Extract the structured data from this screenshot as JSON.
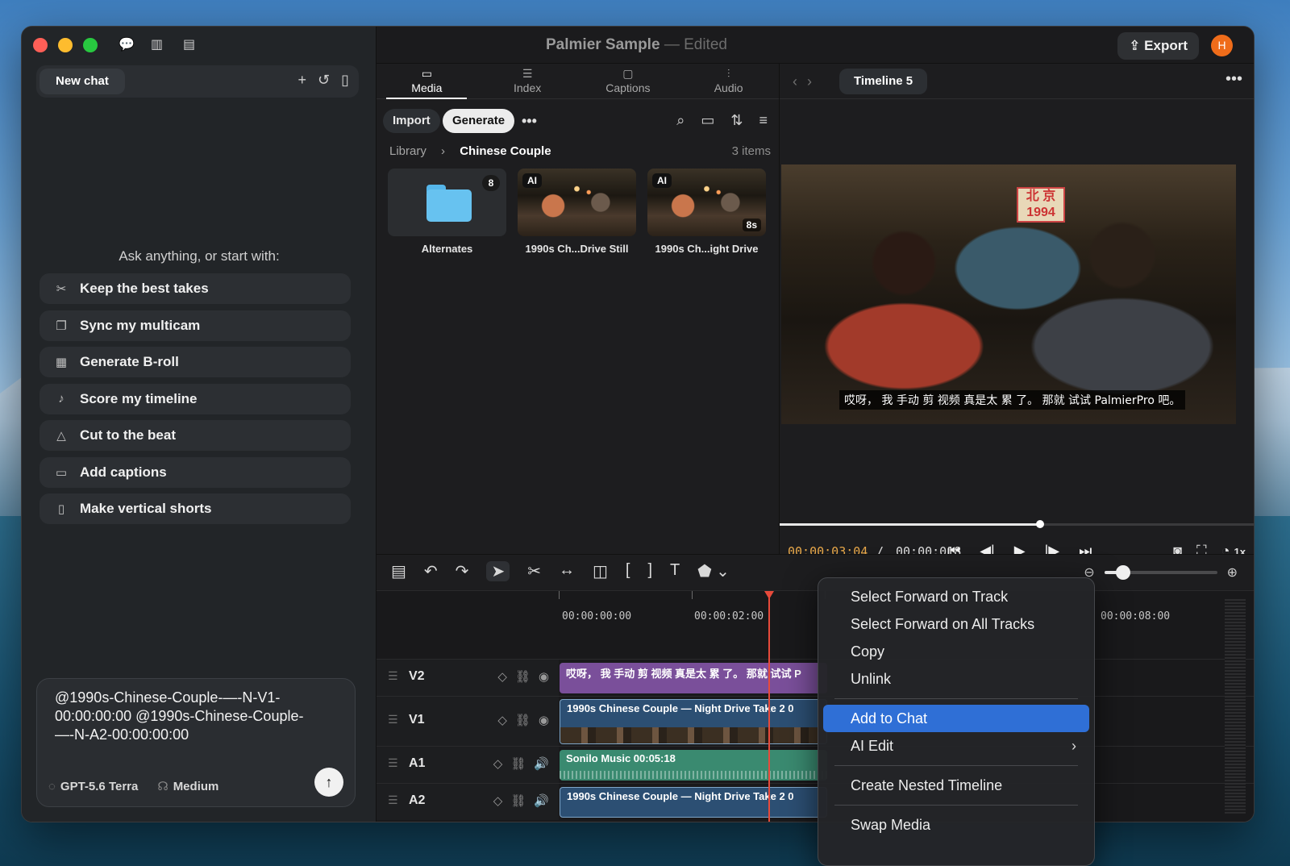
{
  "sidebar": {
    "new_chat": "New chat",
    "ask_prompt": "Ask anything, or start with:",
    "suggestions": [
      {
        "icon": "scissors-icon",
        "label": "Keep the best takes"
      },
      {
        "icon": "multicam-icon",
        "label": "Sync my multicam"
      },
      {
        "icon": "film-icon",
        "label": "Generate B-roll"
      },
      {
        "icon": "music-note-icon",
        "label": "Score my timeline"
      },
      {
        "icon": "metronome-icon",
        "label": "Cut to the beat"
      },
      {
        "icon": "captions-icon",
        "label": "Add captions"
      },
      {
        "icon": "phone-icon",
        "label": "Make vertical shorts"
      }
    ],
    "composer": {
      "text": "@1990s-Chinese-Couple-—-N-V1-00:00:00:00 @1990s-Chinese-Couple-—-N-A2-00:00:00:00",
      "model": "GPT-5.6 Terra",
      "effort": "Medium"
    }
  },
  "titlebar": {
    "project": "Palmier Sample",
    "dash": "—",
    "status": "Edited",
    "export": "Export",
    "avatar": "H"
  },
  "media": {
    "tabs": [
      {
        "label": "Media",
        "active": true
      },
      {
        "label": "Index",
        "active": false
      },
      {
        "label": "Captions",
        "active": false
      },
      {
        "label": "Audio",
        "active": false
      }
    ],
    "import": "Import",
    "generate": "Generate",
    "more": "•••",
    "breadcrumb_root": "Library",
    "breadcrumb_current": "Chinese Couple",
    "item_count": "3 items",
    "items": [
      {
        "name": "Alternates",
        "badge": "8",
        "type": "folder"
      },
      {
        "name": "1990s Ch...Drive Still",
        "badge": "AI",
        "type": "image"
      },
      {
        "name": "1990s Ch...ight Drive",
        "badge": "AI",
        "duration": "8s",
        "type": "video"
      }
    ]
  },
  "viewer": {
    "timeline_name": "Timeline 5",
    "sign_text": "北 京\n1994",
    "subtitle": "哎呀， 我 手动 剪 视频 真是太 累 了。 那就 试试 PalmierPro 吧。",
    "timecode_current": "00:00:03:04",
    "timecode_sep": "/",
    "timecode_total": "00:00:0",
    "timecode_tail": "18",
    "progress": 0.55,
    "speed": "1x"
  },
  "timeline": {
    "ruler": [
      "00:00:00:00",
      "00:00:02:00",
      "00:00:08:00"
    ],
    "zoom_level": 0.17,
    "tracks": [
      {
        "name": "V2",
        "clip": "哎呀， 我 手动 剪 视频 真是太 累 了。 那就 试试 P"
      },
      {
        "name": "V1",
        "clip": "1990s Chinese Couple — Night Drive Take 2  0"
      },
      {
        "name": "A1",
        "clip": "Sonilo Music  00:05:18"
      },
      {
        "name": "A2",
        "clip": "1990s Chinese Couple — Night Drive Take 2  0"
      }
    ]
  },
  "context_menu": {
    "items": [
      "Select Forward on Track",
      "Select Forward on All Tracks",
      "Copy",
      "Unlink",
      "Add to Chat",
      "AI Edit",
      "Create Nested Timeline",
      "Swap Media"
    ],
    "highlighted": "Add to Chat"
  }
}
